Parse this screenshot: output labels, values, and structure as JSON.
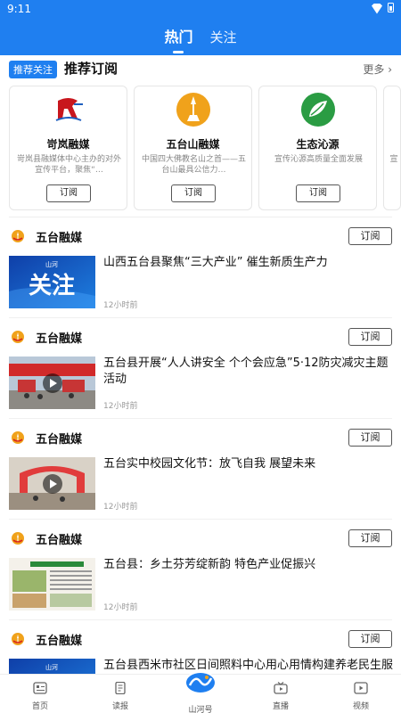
{
  "status_bar": {
    "time": "9:11"
  },
  "header": {
    "tabs": [
      {
        "label": "热门",
        "active": true
      },
      {
        "label": "关注",
        "active": false
      }
    ]
  },
  "recommend": {
    "badge": "推荐关注",
    "title": "推荐订阅",
    "more": "更多",
    "cards": [
      {
        "name": "岢岚融媒",
        "desc": "岢岚县融媒体中心主办的对外宣传平台，聚焦“…",
        "subscribe": "订阅",
        "logo": "kelan-logo"
      },
      {
        "name": "五台山融媒",
        "desc": "中国四大佛教名山之首——五台山最具公信力…",
        "subscribe": "订阅",
        "logo": "wutaishan-logo"
      },
      {
        "name": "生态沁源",
        "desc": "宣传沁源高质量全面发展",
        "subscribe": "订阅",
        "logo": "qinyuan-logo"
      }
    ],
    "partial_card_desc": "宣"
  },
  "feed": [
    {
      "source": "五台融媒",
      "follow": "订阅",
      "headline": "山西五台县聚焦“三大产业” 催生新质生产力",
      "time": "12小时前",
      "thumb": "guanzhu-banner",
      "video": false
    },
    {
      "source": "五台融媒",
      "follow": "订阅",
      "headline": "五台县开展“人人讲安全 个个会应急”5·12防灾减灾主题活动",
      "time": "12小时前",
      "thumb": "event-photo",
      "video": true
    },
    {
      "source": "五台融媒",
      "follow": "订阅",
      "headline": "五台实中校园文化节：放飞自我 展望未来",
      "time": "12小时前",
      "thumb": "school-arch-photo",
      "video": true
    },
    {
      "source": "五台融媒",
      "follow": "订阅",
      "headline": "五台县：乡土芬芳绽新韵 特色产业促振兴",
      "time": "12小时前",
      "thumb": "newspaper-page",
      "video": false
    },
    {
      "source": "五台融媒",
      "follow": "订阅",
      "headline": "五台县西米市社区日间照料中心用心用情构建养老民生服务体系",
      "time": "",
      "thumb": "blue-banner",
      "video": false
    }
  ],
  "bottom_nav": [
    {
      "label": "首页",
      "icon": "home-icon"
    },
    {
      "label": "读报",
      "icon": "newspaper-icon"
    },
    {
      "label": "山河号",
      "icon": "shanhe-logo"
    },
    {
      "label": "直播",
      "icon": "live-tv-icon"
    },
    {
      "label": "视频",
      "icon": "video-icon"
    }
  ],
  "colors": {
    "brand_blue": "#1f7ff0",
    "card_border": "#e6e6e6"
  }
}
